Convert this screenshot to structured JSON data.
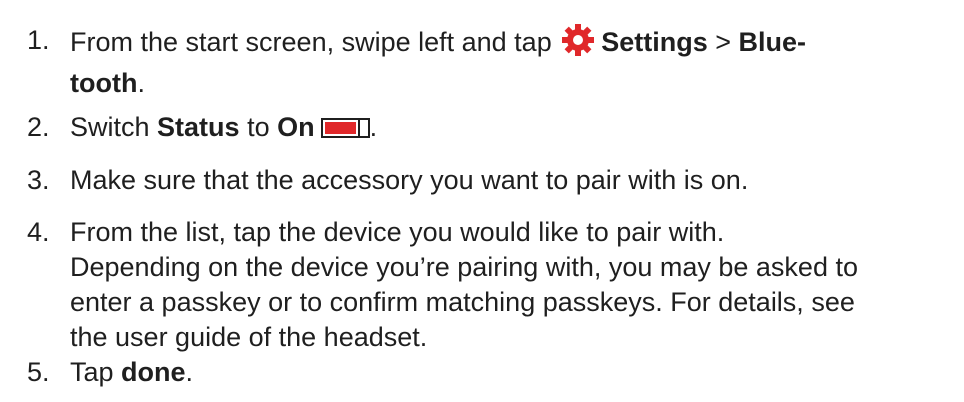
{
  "steps": [
    {
      "num": "1.",
      "t1": "From the start screen, swipe left and tap ",
      "icon": "gear-icon",
      "b1": "Settings",
      "t2": " > ",
      "b2": "Blue-",
      "b3": "tooth",
      "t3": "."
    },
    {
      "num": "2.",
      "t1": "Switch ",
      "b1": "Status",
      "t2": " to ",
      "b2": "On",
      "toggle_state": "on",
      "toggle_color": "#e0282a",
      "t3": "."
    },
    {
      "num": "3.",
      "t1": "Make sure that the accessory you want to pair with is on."
    },
    {
      "num": "4.",
      "lines": [
        "From the list, tap the device you would like to pair with.",
        "Depending on the device you’re pairing with, you may be asked to",
        "enter a passkey or to confirm matching passkeys. For details, see",
        "the user guide of the headset."
      ]
    },
    {
      "num": "5.",
      "t1": "Tap ",
      "b1": "done",
      "t2": "."
    }
  ],
  "colors": {
    "text": "#1f1f1f",
    "gear": "#e0282a"
  }
}
